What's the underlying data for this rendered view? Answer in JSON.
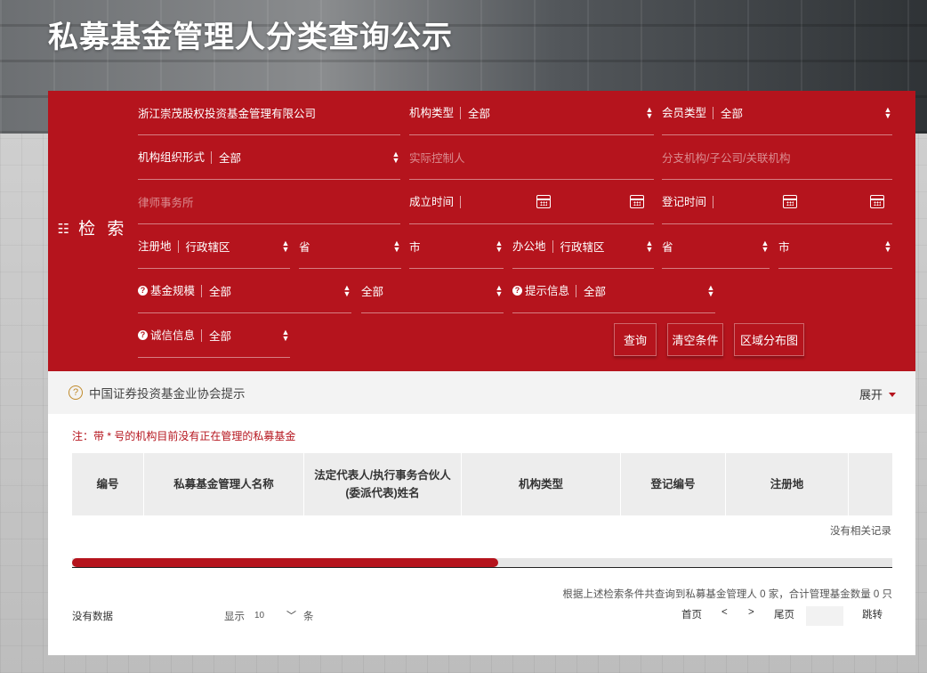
{
  "page": {
    "title": "私募基金管理人分类查询公示"
  },
  "search": {
    "side_label": "检 索",
    "keyword_value": "浙江崇茂股权投资基金管理有限公司",
    "org_type": {
      "label": "机构类型",
      "value": "全部"
    },
    "member_type": {
      "label": "会员类型",
      "value": "全部"
    },
    "org_form": {
      "label": "机构组织形式",
      "value": "全部"
    },
    "controller_placeholder": "实际控制人",
    "branch_placeholder": "分支机构/子公司/关联机构",
    "law_firm_placeholder": "律师事务所",
    "established": {
      "label": "成立时间"
    },
    "registered": {
      "label": "登记时间"
    },
    "reg_place": {
      "label": "注册地",
      "value": "行政辖区",
      "province": "省",
      "city": "市"
    },
    "office_place": {
      "label": "办公地",
      "value": "行政辖区",
      "province": "省",
      "city": "市"
    },
    "fund_scale": {
      "label": "基金规模",
      "value": "全部",
      "value2": "全部"
    },
    "hint_info": {
      "label": "提示信息",
      "value": "全部"
    },
    "credit_info": {
      "label": "诚信信息",
      "value": "全部"
    },
    "buttons": {
      "query": "查询",
      "clear": "清空条件",
      "region_map": "区域分布图"
    }
  },
  "notice": {
    "text": "中国证券投资基金业协会提示",
    "expand_label": "展开"
  },
  "note": "注：带 * 号的机构目前没有正在管理的私募基金",
  "table": {
    "headers": [
      "编号",
      "私募基金管理人名称",
      "法定代表人/执行事务合伙人(委派代表)姓名",
      "机构类型",
      "登记编号",
      "注册地"
    ],
    "header_line1": "法定代表人/执行事务合伙人",
    "header_line2": "(委派代表)姓名",
    "empty_text": "没有相关记录",
    "scroll_fraction": 0.52
  },
  "footer": {
    "summary": "根据上述检索条件共查询到私募基金管理人 0 家，合计管理基金数量 0 只",
    "no_data": "没有数据",
    "show_label": "显示",
    "page_size": "10",
    "unit": "条",
    "first": "首页",
    "prev": "<",
    "next": ">",
    "last": "尾页",
    "jump": "跳转"
  },
  "colors": {
    "brand_red": "#b5141d",
    "notice_icon": "#c08a2a"
  }
}
